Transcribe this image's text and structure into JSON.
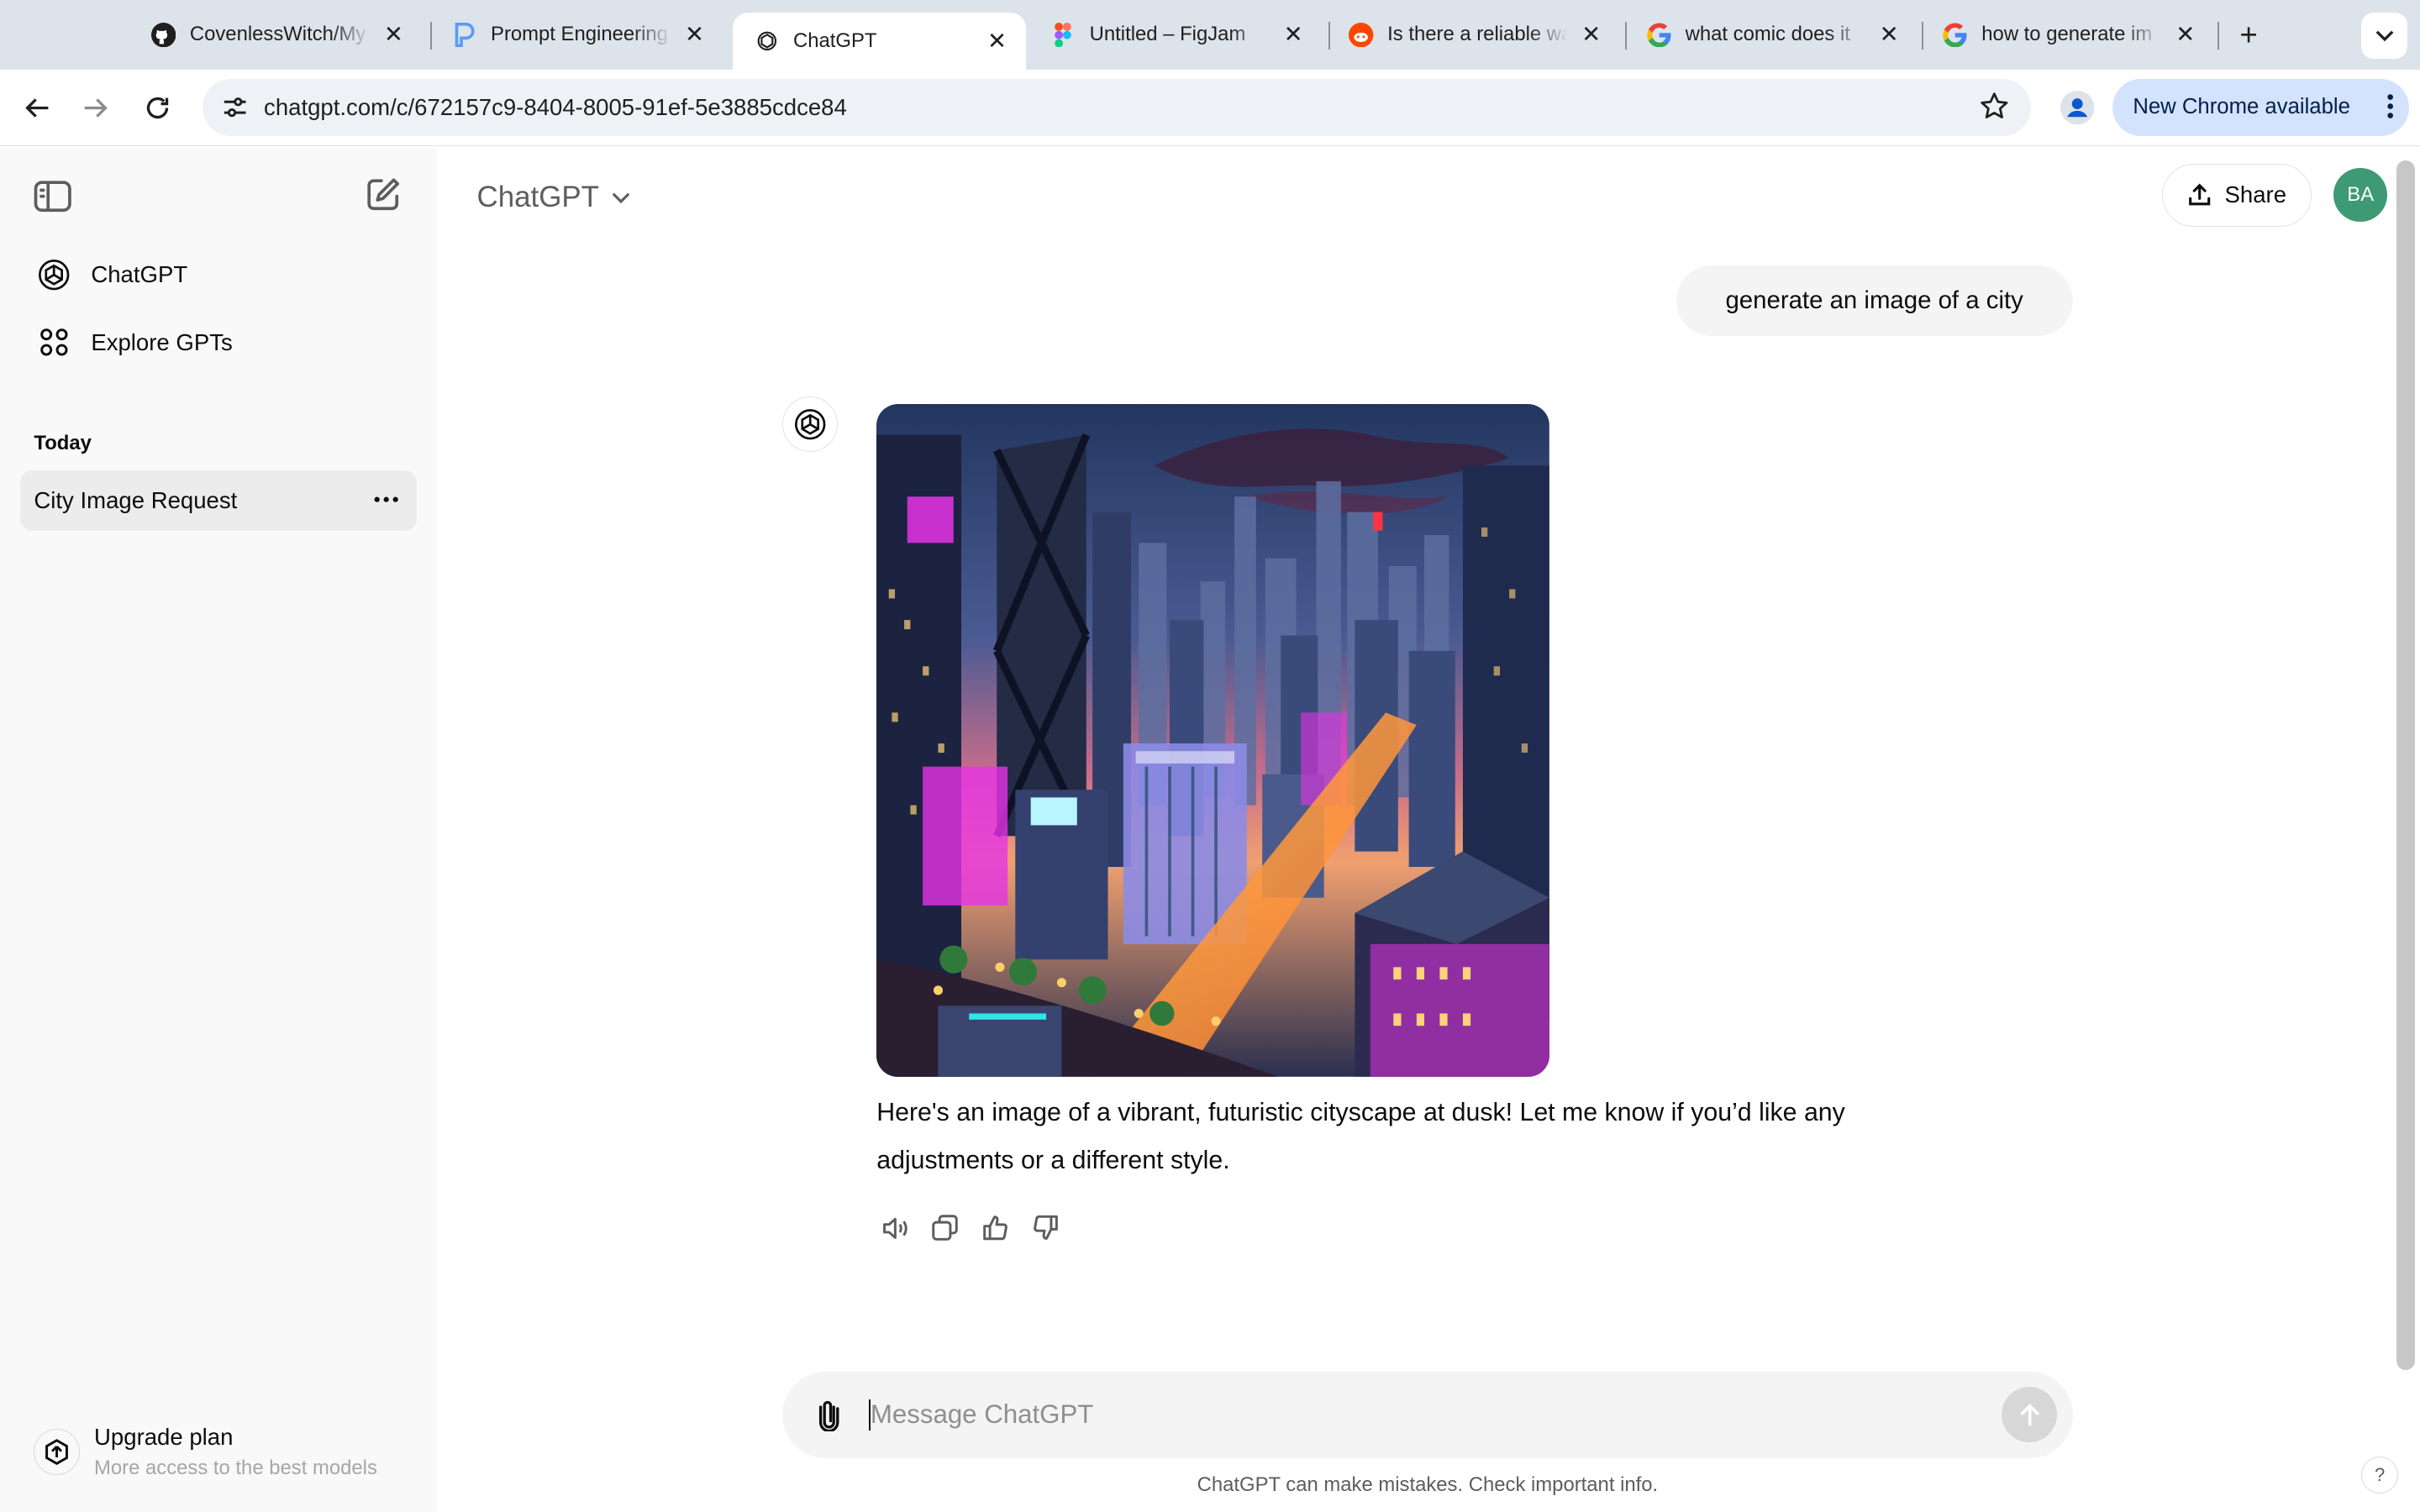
{
  "browser": {
    "tabs": [
      {
        "title": "CovenlessWitch/My",
        "favicon": "github-icon",
        "active": false
      },
      {
        "title": "Prompt Engineering",
        "favicon": "p-logo-icon",
        "active": false
      },
      {
        "title": "ChatGPT",
        "favicon": "openai-icon",
        "active": true
      },
      {
        "title": "Untitled – FigJam",
        "favicon": "figma-icon",
        "active": false
      },
      {
        "title": "Is there a reliable way",
        "favicon": "reddit-icon",
        "active": false
      },
      {
        "title": "what comic does it",
        "favicon": "google-icon",
        "active": false
      },
      {
        "title": "how to generate im",
        "favicon": "google-icon",
        "active": false
      }
    ],
    "new_tab_label": "+",
    "url": "chatgpt.com/c/672157c9-8404-8005-91ef-5e3885cdce84",
    "update_label": "New Chrome available"
  },
  "sidebar": {
    "items": [
      {
        "label": "ChatGPT",
        "icon": "openai-icon"
      },
      {
        "label": "Explore GPTs",
        "icon": "grid-icon"
      }
    ],
    "section_label": "Today",
    "chats": [
      {
        "title": "City Image Request"
      }
    ],
    "upgrade": {
      "title": "Upgrade plan",
      "subtitle": "More access to the best models"
    }
  },
  "main": {
    "model_label": "ChatGPT",
    "share_label": "Share",
    "avatar_initials": "BA",
    "user_message": "generate an image of a city",
    "assistant_reply": "Here's an image of a vibrant, futuristic cityscape at dusk! Let me know if you’d like any adjustments or a different style.",
    "image_alt": "futuristic neon city at dusk",
    "composer_placeholder": "Message ChatGPT",
    "disclaimer": "ChatGPT can make mistakes. Check important info.",
    "help_label": "?"
  },
  "colors": {
    "tabstrip": "#dde3ea",
    "sidebar_bg": "#f9f9f9",
    "avatar_bg": "#3d9a74",
    "update_chip": "#d3e3fd",
    "neon_magenta": "#e632e6",
    "neon_cyan": "#2ee6e6"
  }
}
